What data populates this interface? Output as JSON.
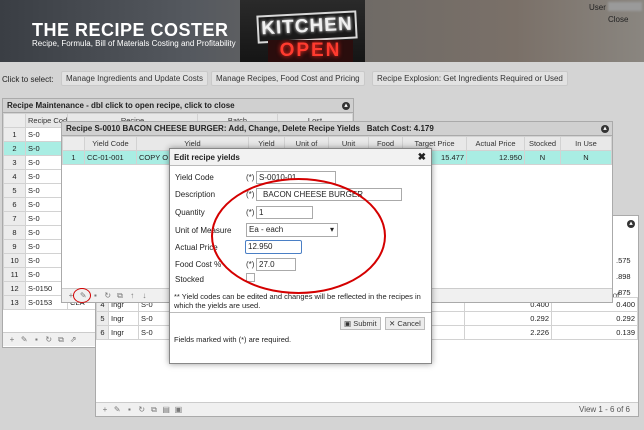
{
  "header": {
    "title": "THE RECIPE COSTER",
    "subtitle": "Recipe, Formula, Bill of Materials Costing and Profitability",
    "sign_kitchen": "KITCHEN",
    "sign_open": "OPEN",
    "user_label": "User",
    "close_link": "Close"
  },
  "select_bar": {
    "label": "Click to select:",
    "buttons": [
      "Manage Ingredients and Update Costs",
      "Manage Recipes, Food Cost and Pricing",
      "Recipe Explosion: Get Ingredients Required or Used"
    ]
  },
  "recipe_maintenance": {
    "title": "Recipe Maintenance - dbl click to open recipe, click to close",
    "headers": [
      "Recipe Code",
      "Recipe",
      "Batch",
      "Lost"
    ],
    "rows": [
      {
        "num": "1",
        "code": "S-0"
      },
      {
        "num": "2",
        "code": "S-0"
      },
      {
        "num": "3",
        "code": "S-0"
      },
      {
        "num": "4",
        "code": "S-0"
      },
      {
        "num": "5",
        "code": "S-0"
      },
      {
        "num": "6",
        "code": "S-0"
      },
      {
        "num": "7",
        "code": "S-0"
      },
      {
        "num": "8",
        "code": "S-0"
      },
      {
        "num": "9",
        "code": "S-0"
      },
      {
        "num": "10",
        "code": "S-0"
      },
      {
        "num": "11",
        "code": "S-0"
      },
      {
        "num": "12",
        "code": "S-0150",
        "name": "AU"
      },
      {
        "num": "13",
        "code": "S-0153",
        "name": "CLA"
      }
    ]
  },
  "yields_panel": {
    "title": "Recipe S-0010 BACON CHEESE BURGER: Add, Change, Delete Recipe Yields",
    "batch_cost": "Batch Cost: 4.179",
    "headers": [
      "Yield Code",
      "Yield",
      "Yield",
      "Unit of",
      "Unit",
      "Food",
      "Target Price",
      "Actual Price",
      "Stocked",
      "In Use"
    ],
    "row": {
      "num": "1",
      "code": "CC-01-001",
      "desc": "COPY O",
      "target": "15.477",
      "actual": "12.950",
      "stocked": "N",
      "in_use": "N"
    }
  },
  "ingredients_panel": {
    "right_values": [
      ".575",
      ".898",
      ".875"
    ],
    "rows": [
      {
        "num": "4",
        "type": "Ingr",
        "code": "S-0",
        "unit": "Ea",
        "cost": "0.400",
        "ext": "0.400"
      },
      {
        "num": "5",
        "type": "Ingr",
        "code": "S-0",
        "unit": "Ozw",
        "cost": "0.292",
        "ext": "0.292"
      },
      {
        "num": "6",
        "type": "Ingr",
        "code": "S-0",
        "unit": "Qt",
        "cost": "2.226",
        "ext": "0.139"
      }
    ],
    "pager": "View 1 - 6 of 6",
    "pager_short": "View 1 - 1 of"
  },
  "dialog": {
    "title": "Edit recipe yields",
    "close_icon": "✖",
    "req": "(*)",
    "fields": {
      "yield_code": {
        "label": "Yield Code",
        "value": "S-0010-01"
      },
      "description": {
        "label": "Description",
        "value": "BACON CHEESE BURGER"
      },
      "quantity": {
        "label": "Quantity",
        "value": "1"
      },
      "unit": {
        "label": "Unit of Measure",
        "value": "Ea - each",
        "arrow": "▾"
      },
      "actual_price": {
        "label": "Actual Price",
        "value": "12.950"
      },
      "food_cost": {
        "label": "Food Cost %",
        "value": "27.0"
      },
      "stocked": {
        "label": "Stocked"
      }
    },
    "note": "** Yield codes can be edited and changes will be reflected in the recipes in which the yields are used.",
    "submit": "Submit",
    "cancel": "Cancel",
    "footer": "Fields marked with (*) are required."
  }
}
